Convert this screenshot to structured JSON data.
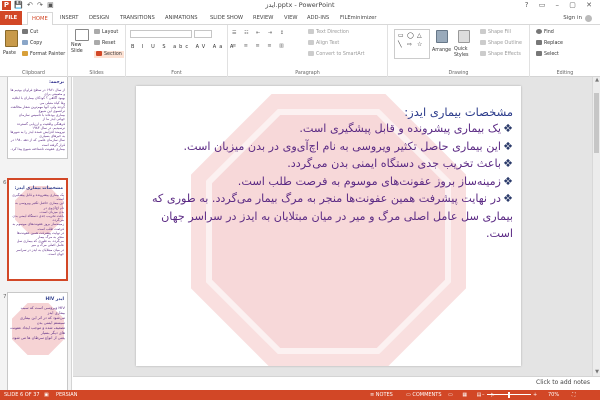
{
  "window": {
    "title": "ایدز.pptx - PowerPoint",
    "app_letter": "P",
    "controls": "? ▭ – ▢ ✕"
  },
  "tabs": [
    "FILE",
    "HOME",
    "INSERT",
    "DESIGN",
    "TRANSITIONS",
    "ANIMATIONS",
    "SLIDE SHOW",
    "REVIEW",
    "VIEW",
    "ADD-INS",
    "FILEminimizer"
  ],
  "active_tab": "HOME",
  "signin": "Sign in",
  "ribbon": {
    "clipboard": {
      "label": "Clipboard",
      "paste": "Paste",
      "cut": "Cut",
      "copy": "Copy",
      "format_painter": "Format Painter"
    },
    "slides": {
      "label": "Slides",
      "new_slide": "New Slide",
      "layout": "Layout",
      "reset": "Reset",
      "section": "Section"
    },
    "font": {
      "label": "Font",
      "format_row1": "B I U S abc AV Aa A",
      "font_name": "",
      "font_size": ""
    },
    "paragraph": {
      "label": "Paragraph",
      "text_direction": "Text Direction",
      "align_text": "Align Text",
      "convert_smartart": "Convert to SmartArt"
    },
    "drawing": {
      "label": "Drawing",
      "arrange": "Arrange",
      "quick_styles": "Quick Styles",
      "shape_fill": "Shape Fill",
      "shape_outline": "Shape Outline",
      "shape_effects": "Shape Effects"
    },
    "editing": {
      "label": "Editing",
      "find": "Find",
      "replace": "Replace",
      "select": "Select"
    }
  },
  "thumbnails": [
    {
      "number": "",
      "title": "ترجمه:",
      "lines": [
        "از سال ۱۹۸۱ در سطح فراوان بودیم ها و مصیبتی برای",
        "بهبود آگاهی ؟ کودکان بیماران با ابتلایه وفا کیاه متبلی می",
        "کردند ولی، آنها مهم‌ترین شعار مخالفت ترانسوی این شیوع",
        "بیماری بوده‌اند با تاسیس سازمان جهانی ایدز ما از",
        "فرهنگی واقعیت و ارزیابی گسترده نرسیدیم. در سال ۱۹۸۳",
        "نیرومند افزایش عمده ایدز را به شهرها به خبرهای بسیاری",
        "سال سازمان علمی که از دهه ۱۹۸۰ در قرار گرفته است",
        "بیماری عفونت ناشناخته شیوع پیدا کرد."
      ]
    },
    {
      "number": "6",
      "title": "مشخصات بیماری ایدز:",
      "lines": [
        "یک بیماری پیشرونده و قابل پیشگیری است.",
        "این بیماری حاصل تکثیر ویروسی به نام اچ‌آی‌وی در",
        "بدن میزبان است.",
        "باعث تخریب جدی دستگاه ایمنی بدن می‌گردد.",
        "زمینه‌ساز بروز عفونت‌های موسوم به فرصت طلب است.",
        "در نهایت پیشرفت همین عفونت‌ها منجر به مرگ بیمار",
        "می‌گردد. به طوری که بیماری سل عامل اصلی مرگ و میر",
        "در میان مبتلایان به ایدز در سراسر جهان است."
      ]
    },
    {
      "number": "7",
      "title": "ایدز HIV",
      "lines": [
        "HIV ویروسی است که سبب بیماری ایدز",
        "می‌شود که در اثر این بیماری سیستم ایمنی بدن",
        "تضعیف شده و موجب ایجاد عفونت های دیگر بسیار",
        "یعنی از انواع سرطان ها می شود."
      ]
    }
  ],
  "slide": {
    "title": "مشخصات بیماری ایدز:",
    "bullet_symbol": "❖",
    "bullets": [
      "یک بیماری پیشرونده و قابل پیشگیری است.",
      "این بیماری حاصل تکثیر ویروسی به نام اچ‌آی‌وی در بدن میزبان است.",
      "باعث تخریب جدی دستگاه ایمنی بدن می‌گردد.",
      "زمینه‌ساز بروز عفونت‌های موسوم به فرصت طلب است.",
      "در نهایت پیشرفت همین عفونت‌ها منجر به مرگ بیمار می‌گردد. به طوری که بیماری سل عامل اصلی مرگ و میر در میان مبتلایان به ایدز در سراسر جهان است."
    ]
  },
  "notes_placeholder": "Click to add notes",
  "status": {
    "slide_info": "SLIDE 6 OF 37",
    "language": "PERSIAN",
    "notes": "NOTES",
    "comments": "COMMENTS",
    "zoom": "70%",
    "zoom_fraction": 0.45
  },
  "colors": {
    "accent": "#d24726",
    "title_text": "#2a3a8a",
    "body_text": "#5b2a84",
    "stop_red": "#d7373b"
  }
}
